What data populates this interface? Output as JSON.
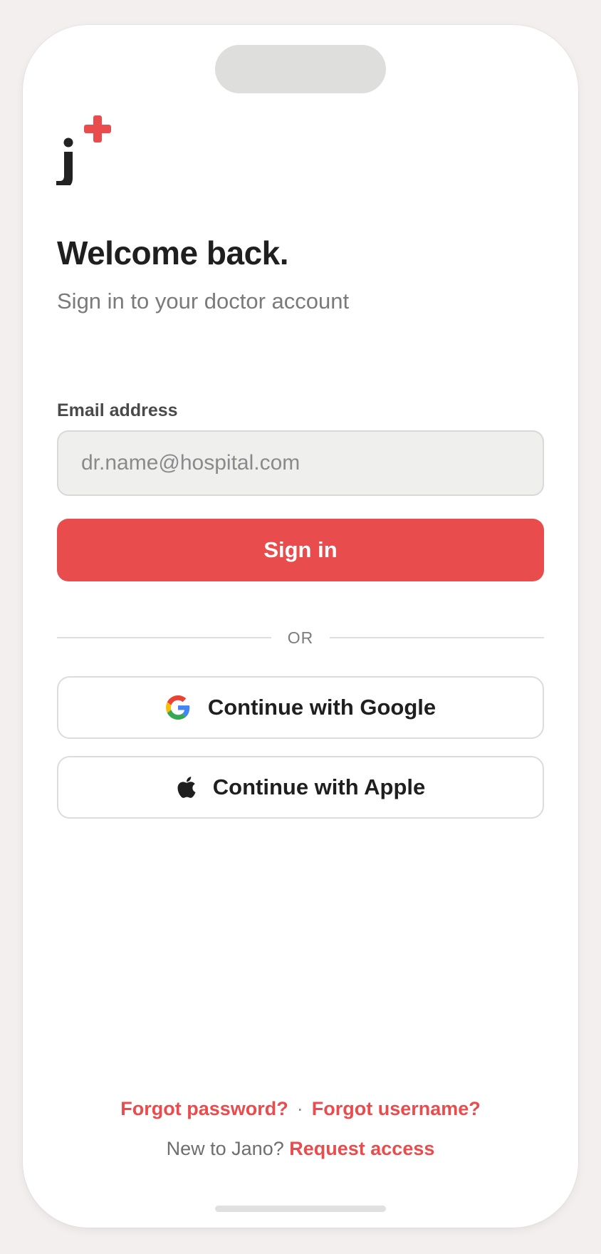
{
  "brand": {
    "logo_icon": "jano-plus-logo-icon",
    "accent_color": "#e84c4d"
  },
  "header": {
    "title": "Welcome back.",
    "subtitle": "Sign in to your doctor account"
  },
  "form": {
    "email_label": "Email address",
    "email_value": "",
    "email_placeholder": "dr.name@hospital.com",
    "signin_label": "Sign in"
  },
  "divider": {
    "label": "OR"
  },
  "social": {
    "google_label": "Continue with Google",
    "google_icon": "google-icon",
    "apple_label": "Continue with Apple",
    "apple_icon": "apple-icon"
  },
  "footer": {
    "forgot_password": "Forgot password?",
    "separator": "·",
    "forgot_username": "Forgot username?",
    "new_prompt": "New to Jano?",
    "request_access": "Request access"
  }
}
